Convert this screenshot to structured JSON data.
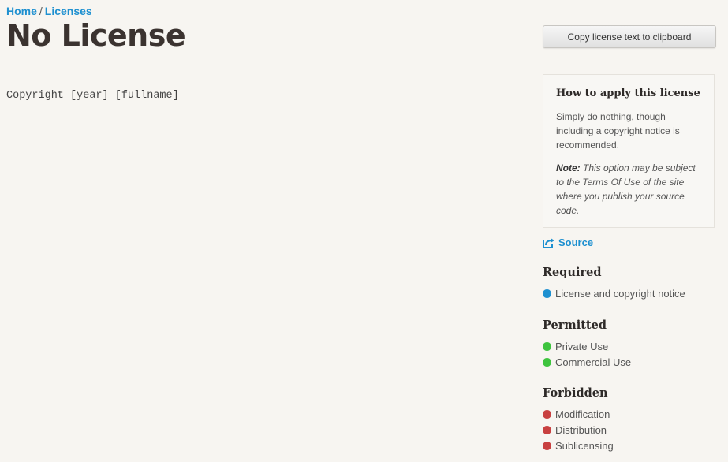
{
  "breadcrumb": {
    "home": "Home",
    "separator": "/",
    "licenses": "Licenses"
  },
  "page_title": "No License",
  "license_text": "Copyright [year] [fullname]",
  "copy_button_label": "Copy license text to clipboard",
  "apply_box": {
    "title": "How to apply this license",
    "description": "Simply do nothing, though including a copyright notice is recommended.",
    "note_label": "Note:",
    "note_text": "This option may be subject to the Terms Of Use of the site where you publish your source code."
  },
  "source_link": {
    "label": "Source",
    "icon": "external-link-icon"
  },
  "colors": {
    "link": "#1e90d0",
    "required": "#1e90d0",
    "permitted": "#3ec43e",
    "forbidden": "#c84040"
  },
  "required": {
    "heading": "Required",
    "items": [
      "License and copyright notice"
    ]
  },
  "permitted": {
    "heading": "Permitted",
    "items": [
      "Private Use",
      "Commercial Use"
    ]
  },
  "forbidden": {
    "heading": "Forbidden",
    "items": [
      "Modification",
      "Distribution",
      "Sublicensing"
    ]
  }
}
